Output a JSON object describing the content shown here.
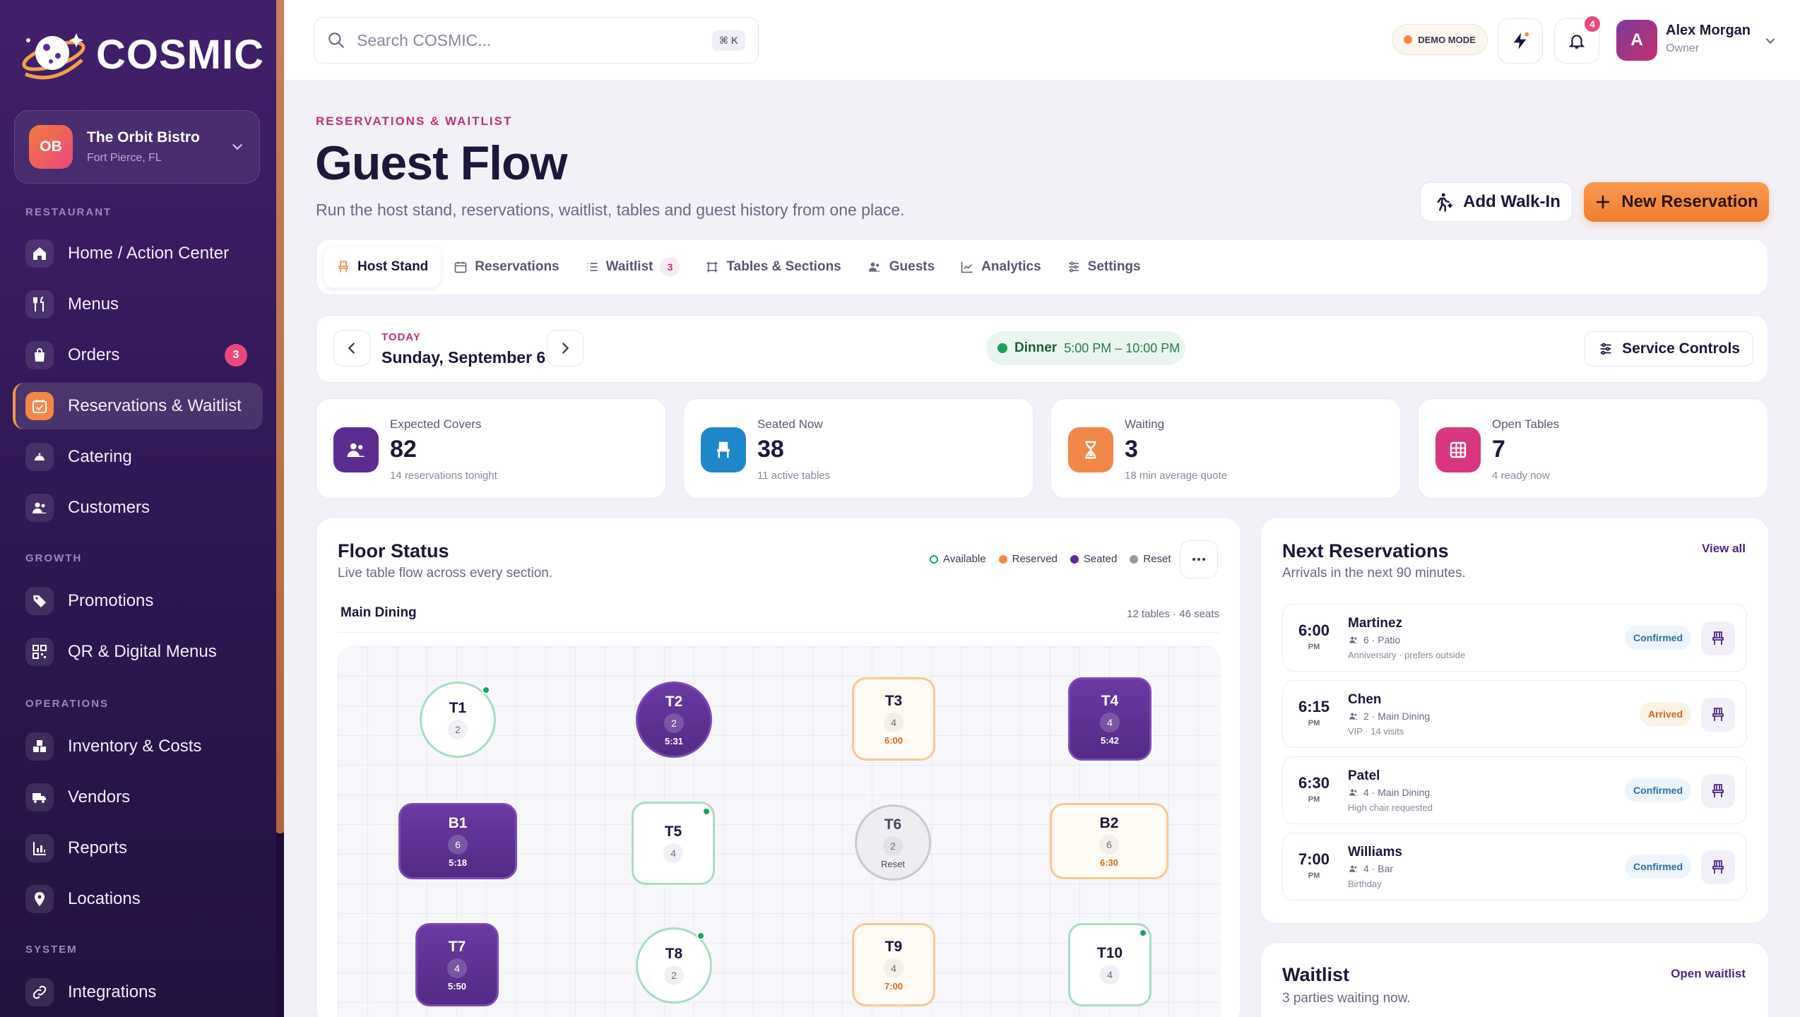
{
  "brand": {
    "name": "COSMIC"
  },
  "business": {
    "initials": "OB",
    "name": "The Orbit Bistro",
    "location": "Fort Pierce, FL"
  },
  "sidebar": {
    "sections": [
      {
        "label": "RESTAURANT"
      },
      {
        "label": "GROWTH"
      },
      {
        "label": "OPERATIONS"
      },
      {
        "label": "SYSTEM"
      }
    ],
    "items": [
      {
        "label": "Home / Action Center",
        "icon": "home-icon"
      },
      {
        "label": "Menus",
        "icon": "utensils-icon"
      },
      {
        "label": "Orders",
        "icon": "bag-icon",
        "badge": "3"
      },
      {
        "label": "Reservations & Waitlist",
        "icon": "calendar-icon",
        "active": true
      },
      {
        "label": "Catering",
        "icon": "cloche-icon"
      },
      {
        "label": "Customers",
        "icon": "users-icon"
      },
      {
        "label": "Promotions",
        "icon": "tag-icon"
      },
      {
        "label": "QR & Digital Menus",
        "icon": "qr-icon"
      },
      {
        "label": "Inventory & Costs",
        "icon": "boxes-icon"
      },
      {
        "label": "Vendors",
        "icon": "truck-icon"
      },
      {
        "label": "Reports",
        "icon": "chart-icon"
      },
      {
        "label": "Locations",
        "icon": "pin-icon"
      },
      {
        "label": "Integrations",
        "icon": "link-icon"
      }
    ]
  },
  "topbar": {
    "search_placeholder": "Search COSMIC...",
    "shortcut": "⌘ K",
    "demo_mode": "DEMO MODE",
    "notification_count": "4",
    "user": {
      "initial": "A",
      "name": "Alex Morgan",
      "role": "Owner"
    }
  },
  "header": {
    "eyebrow": "RESERVATIONS & WAITLIST",
    "title": "Guest Flow",
    "subtitle": "Run the host stand, reservations, waitlist, tables and guest history from one place.",
    "add_walkin": "Add Walk-In",
    "new_reservation": "New Reservation"
  },
  "tabs": [
    {
      "label": "Host Stand",
      "icon": "chair-icon",
      "active": true
    },
    {
      "label": "Reservations",
      "icon": "calendar-icon"
    },
    {
      "label": "Waitlist",
      "icon": "list-icon",
      "count": "3"
    },
    {
      "label": "Tables & Sections",
      "icon": "layout-icon"
    },
    {
      "label": "Guests",
      "icon": "users-icon"
    },
    {
      "label": "Analytics",
      "icon": "trend-icon"
    },
    {
      "label": "Settings",
      "icon": "sliders-icon"
    }
  ],
  "date_bar": {
    "today_label": "TODAY",
    "date": "Sunday, September 6",
    "service_name": "Dinner",
    "service_hours": "5:00 PM – 10:00 PM",
    "service_controls": "Service Controls"
  },
  "stats": [
    {
      "label": "Expected Covers",
      "value": "82",
      "sub": "14 reservations tonight",
      "color": "#5b2d91",
      "icon": "users-icon"
    },
    {
      "label": "Seated Now",
      "value": "38",
      "sub": "11 active tables",
      "color": "#1f86c9",
      "icon": "chair-icon"
    },
    {
      "label": "Waiting",
      "value": "3",
      "sub": "18 min average quote",
      "color": "#f2874a",
      "icon": "hourglass-icon"
    },
    {
      "label": "Open Tables",
      "value": "7",
      "sub": "4 ready now",
      "color": "#d8367f",
      "icon": "grid-icon"
    }
  ],
  "floor": {
    "title": "Floor Status",
    "subtitle": "Live table flow across every section.",
    "legend": [
      {
        "label": "Available",
        "color": "#19a25c"
      },
      {
        "label": "Reserved",
        "color": "#f2874a"
      },
      {
        "label": "Seated",
        "color": "#5b2d91"
      },
      {
        "label": "Reset",
        "color": "#9a98a6"
      }
    ],
    "section_name": "Main Dining",
    "section_meta": "12 tables · 46 seats",
    "tables": [
      {
        "name": "T1",
        "size": "2",
        "time": "",
        "status": "available"
      },
      {
        "name": "T2",
        "size": "2",
        "time": "5:31",
        "status": "seated"
      },
      {
        "name": "T3",
        "size": "4",
        "time": "6:00",
        "status": "reserved"
      },
      {
        "name": "T4",
        "size": "4",
        "time": "5:42",
        "status": "seated"
      },
      {
        "name": "B1",
        "size": "6",
        "time": "5:18",
        "status": "seated"
      },
      {
        "name": "T5",
        "size": "4",
        "time": "",
        "status": "available"
      },
      {
        "name": "T6",
        "size": "2",
        "time": "Reset",
        "status": "reset"
      },
      {
        "name": "B2",
        "size": "6",
        "time": "6:30",
        "status": "reserved"
      },
      {
        "name": "T7",
        "size": "4",
        "time": "5:50",
        "status": "seated"
      },
      {
        "name": "T8",
        "size": "2",
        "time": "",
        "status": "available"
      },
      {
        "name": "T9",
        "size": "4",
        "time": "7:00",
        "status": "reserved"
      },
      {
        "name": "T10",
        "size": "4",
        "time": "",
        "status": "available"
      }
    ]
  },
  "next_reservations": {
    "title": "Next Reservations",
    "subtitle": "Arrivals in the next 90 minutes.",
    "view_all": "View all",
    "items": [
      {
        "time": "6:00",
        "ampm": "PM",
        "name": "Martinez",
        "party": "6 · Patio",
        "note": "Anniversary · prefers outside",
        "status": "Confirmed"
      },
      {
        "time": "6:15",
        "ampm": "PM",
        "name": "Chen",
        "party": "2 · Main Dining",
        "note": "VIP · 14 visits",
        "status": "Arrived"
      },
      {
        "time": "6:30",
        "ampm": "PM",
        "name": "Patel",
        "party": "4 · Main Dining",
        "note": "High chair requested",
        "status": "Confirmed"
      },
      {
        "time": "7:00",
        "ampm": "PM",
        "name": "Williams",
        "party": "4 · Bar",
        "note": "Birthday",
        "status": "Confirmed"
      }
    ]
  },
  "waitlist": {
    "title": "Waitlist",
    "subtitle": "3 parties waiting now.",
    "open_label": "Open waitlist"
  }
}
